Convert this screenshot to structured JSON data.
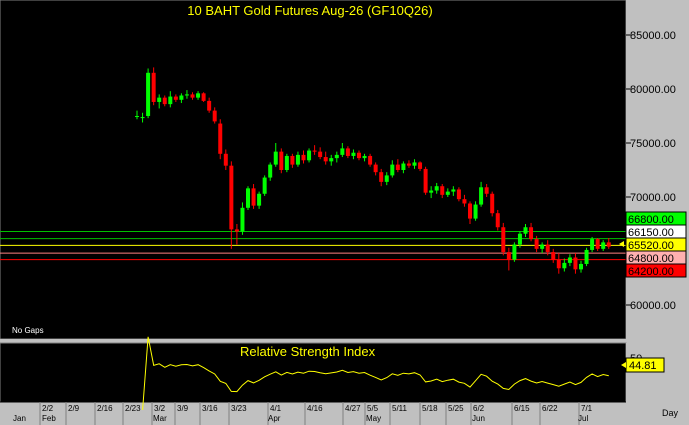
{
  "title": "10 BAHT Gold Futures Aug-26 (GF10Q26)",
  "no_gaps_label": "No Gaps",
  "rsi": {
    "title": "Relative Strength Index",
    "tick_label": "50",
    "last_value": "44.81"
  },
  "x_axis": {
    "week_ticks": [
      "2/2",
      "2/9",
      "2/16",
      "2/23",
      "3/2",
      "3/9",
      "3/16",
      "3/23",
      "4/1",
      "4/16",
      "4/27",
      "5/5",
      "5/11",
      "5/18",
      "5/25",
      "6/2",
      "6/15",
      "6/22",
      "7/1"
    ],
    "month_labels": [
      "Jan",
      "Feb",
      "Mar",
      "Apr",
      "May",
      "Jun",
      "Jul"
    ],
    "period_label": "Day"
  },
  "price_axis": {
    "ticks": [
      "85000.00",
      "80000.00",
      "75000.00",
      "70000.00",
      "65000.00",
      "60000.00"
    ]
  },
  "levels": [
    {
      "label": "66800.00",
      "value": 66800,
      "color": "#00c000",
      "text_bg": "#00ff00"
    },
    {
      "label": "66150.00",
      "value": 66150,
      "color": "#00c000",
      "text_bg": "#ffffff"
    },
    {
      "label": "65520.00",
      "value": 65520,
      "color": "#ffff00",
      "text_bg": "#ffff00"
    },
    {
      "label": "64800.00",
      "value": 64800,
      "color": "#ff8080",
      "text_bg": "#ffb0b0"
    },
    {
      "label": "64200.00",
      "value": 64200,
      "color": "#ff0000",
      "text_bg": "#ff0000"
    }
  ],
  "colors": {
    "up": "#00ff00",
    "down": "#ff0000",
    "background": "#000000",
    "rsi_line": "#ffff00"
  },
  "chart_data": {
    "type": "candlestick",
    "title": "10 BAHT Gold Futures Aug-26 (GF10Q26)",
    "ylim": [
      55500,
      88000
    ],
    "ohlc": [
      [
        77500,
        78000,
        77200,
        77500
      ],
      [
        77400,
        77800,
        76900,
        77400
      ],
      [
        77500,
        81900,
        77300,
        81500
      ],
      [
        81500,
        82000,
        78500,
        78800
      ],
      [
        78800,
        79500,
        78200,
        79200
      ],
      [
        79200,
        79400,
        78400,
        78600
      ],
      [
        78600,
        79800,
        78300,
        79300
      ],
      [
        79300,
        79500,
        78800,
        79000
      ],
      [
        79000,
        79600,
        78700,
        79400
      ],
      [
        79400,
        79900,
        79100,
        79500
      ],
      [
        79500,
        79700,
        79000,
        79200
      ],
      [
        79200,
        79800,
        79000,
        79600
      ],
      [
        79600,
        79700,
        78800,
        78900
      ],
      [
        78900,
        79200,
        77800,
        78000
      ],
      [
        78000,
        78300,
        76800,
        77000
      ],
      [
        76800,
        77200,
        73500,
        74000
      ],
      [
        74000,
        74400,
        72500,
        72900
      ],
      [
        72900,
        73300,
        65200,
        67000
      ],
      [
        67000,
        67500,
        65600,
        66800
      ],
      [
        66800,
        69500,
        66500,
        69000
      ],
      [
        69000,
        71000,
        68800,
        70800
      ],
      [
        70800,
        71200,
        68900,
        69200
      ],
      [
        69200,
        70500,
        68900,
        70300
      ],
      [
        70300,
        72000,
        70100,
        71800
      ],
      [
        71800,
        73200,
        71500,
        73000
      ],
      [
        73000,
        75000,
        72800,
        74200
      ],
      [
        74200,
        74500,
        72200,
        72500
      ],
      [
        72500,
        74000,
        72300,
        73800
      ],
      [
        73800,
        74000,
        72700,
        73000
      ],
      [
        73000,
        74200,
        72800,
        73900
      ],
      [
        73900,
        74300,
        73100,
        73400
      ],
      [
        73400,
        74500,
        73200,
        74300
      ],
      [
        74300,
        74800,
        73900,
        74200
      ],
      [
        74200,
        74600,
        73500,
        73700
      ],
      [
        73700,
        74200,
        73000,
        73300
      ],
      [
        73300,
        73900,
        72900,
        73600
      ],
      [
        73600,
        74200,
        73200,
        73900
      ],
      [
        73900,
        75000,
        73700,
        74500
      ],
      [
        74500,
        74700,
        73600,
        73800
      ],
      [
        73800,
        74400,
        73500,
        74100
      ],
      [
        74100,
        74300,
        73400,
        73600
      ],
      [
        73600,
        74000,
        73300,
        73800
      ],
      [
        73800,
        74000,
        72800,
        73000
      ],
      [
        73000,
        73200,
        72000,
        72300
      ],
      [
        72300,
        72600,
        71000,
        71400
      ],
      [
        71400,
        72300,
        71100,
        72000
      ],
      [
        72000,
        73400,
        71800,
        73000
      ],
      [
        73000,
        73500,
        72300,
        72500
      ],
      [
        72500,
        73300,
        72200,
        73100
      ],
      [
        73100,
        73400,
        72700,
        72900
      ],
      [
        72900,
        73500,
        72600,
        73200
      ],
      [
        73200,
        73300,
        72400,
        72600
      ],
      [
        72600,
        72800,
        70200,
        70400
      ],
      [
        70400,
        71000,
        69900,
        70600
      ],
      [
        70600,
        71300,
        70300,
        71000
      ],
      [
        71000,
        71200,
        69900,
        70200
      ],
      [
        70200,
        70800,
        70000,
        70500
      ],
      [
        70500,
        71000,
        70100,
        70700
      ],
      [
        70700,
        70900,
        69600,
        69800
      ],
      [
        69800,
        70200,
        69100,
        69400
      ],
      [
        69400,
        69600,
        67500,
        68000
      ],
      [
        68000,
        69600,
        67800,
        69300
      ],
      [
        69300,
        71400,
        69100,
        70900
      ],
      [
        70900,
        71200,
        70000,
        70300
      ],
      [
        70300,
        70500,
        68200,
        68500
      ],
      [
        68500,
        68800,
        66900,
        67200
      ],
      [
        67200,
        67600,
        64600,
        64900
      ],
      [
        64900,
        65300,
        63200,
        64200
      ],
      [
        64200,
        65800,
        64000,
        65600
      ],
      [
        65600,
        66800,
        65300,
        66600
      ],
      [
        66600,
        67500,
        66300,
        67200
      ],
      [
        67200,
        67600,
        65900,
        66100
      ],
      [
        66100,
        66400,
        64900,
        65200
      ],
      [
        65200,
        65800,
        64800,
        65600
      ],
      [
        65600,
        66000,
        64600,
        64900
      ],
      [
        64900,
        65200,
        63900,
        64200
      ],
      [
        64200,
        64800,
        62900,
        63400
      ],
      [
        63400,
        64300,
        63100,
        63900
      ],
      [
        63900,
        64700,
        63600,
        64400
      ],
      [
        64400,
        64800,
        62900,
        63300
      ],
      [
        63300,
        64100,
        63000,
        63800
      ],
      [
        63800,
        65300,
        63600,
        65100
      ],
      [
        65100,
        66300,
        64900,
        66100
      ],
      [
        66100,
        66200,
        65000,
        65200
      ],
      [
        65200,
        66000,
        65000,
        65800
      ],
      [
        65800,
        66200,
        65200,
        65400
      ]
    ]
  }
}
